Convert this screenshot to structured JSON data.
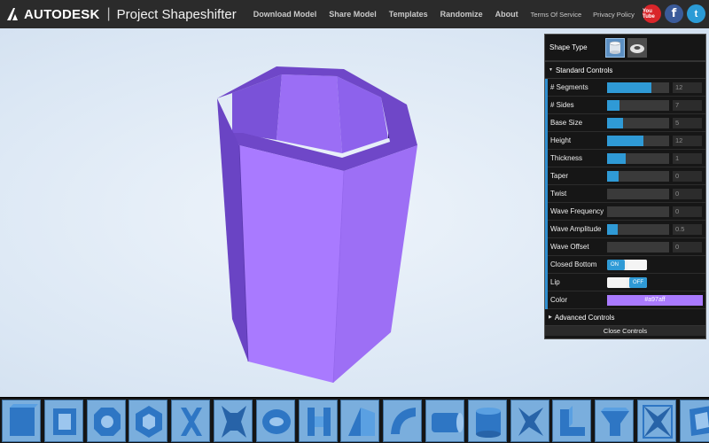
{
  "header": {
    "brand": "AUTODESK",
    "separator": "|",
    "product": "Project Shapeshifter",
    "nav": [
      {
        "label": "Download Model"
      },
      {
        "label": "Share Model"
      },
      {
        "label": "Templates"
      },
      {
        "label": "Randomize"
      },
      {
        "label": "About"
      },
      {
        "label": "Terms Of Service"
      },
      {
        "label": "Privacy Policy"
      }
    ],
    "social": {
      "youtube": "You Tube",
      "facebook": "f",
      "twitter": "t"
    }
  },
  "controls": {
    "shape_type_label": "Shape Type",
    "shape_types": [
      {
        "icon": "cylinder-shape-icon",
        "selected": true
      },
      {
        "icon": "torus-shape-icon",
        "selected": false
      }
    ],
    "standard_header": "Standard Controls",
    "sliders": [
      {
        "label": "# Segments",
        "value": "12",
        "fill": 0.72
      },
      {
        "label": "# Sides",
        "value": "7",
        "fill": 0.2
      },
      {
        "label": "Base Size",
        "value": "5",
        "fill": 0.25
      },
      {
        "label": "Height",
        "value": "12",
        "fill": 0.58
      },
      {
        "label": "Thickness",
        "value": "1",
        "fill": 0.3
      },
      {
        "label": "Taper",
        "value": "0",
        "fill": 0.18
      },
      {
        "label": "Twist",
        "value": "0",
        "fill": 0.0
      },
      {
        "label": "Wave Frequency",
        "value": "0",
        "fill": 0.0
      },
      {
        "label": "Wave Amplitude",
        "value": "0.5",
        "fill": 0.17
      },
      {
        "label": "Wave Offset",
        "value": "0",
        "fill": 0.0
      }
    ],
    "closed_bottom": {
      "label": "Closed Bottom",
      "state": "ON"
    },
    "lip": {
      "label": "Lip",
      "state": "OFF"
    },
    "color": {
      "label": "Color",
      "value": "#a97aff"
    },
    "advanced_header": "Advanced Controls",
    "close_label": "Close Controls"
  },
  "colors": {
    "model": "#a97aff",
    "accent": "#2f9ad6"
  },
  "gallery": {
    "templates": [
      "box-template-icon",
      "square-frame-template-icon",
      "octagon-ring-template-icon",
      "hexagon-ring-template-icon",
      "x-cross-template-icon",
      "twisted-cross-template-icon",
      "eye-ring-template-icon",
      "pillar-template-icon",
      "folded-sheet-template-icon",
      "curved-panel-template-icon",
      "cylinder-lying-template-icon",
      "cylinder-upright-template-icon",
      "twisted-star-template-icon",
      "l-step-template-icon",
      "funnel-template-icon",
      "star-square-template-icon",
      "twisted-box-template-icon"
    ]
  }
}
